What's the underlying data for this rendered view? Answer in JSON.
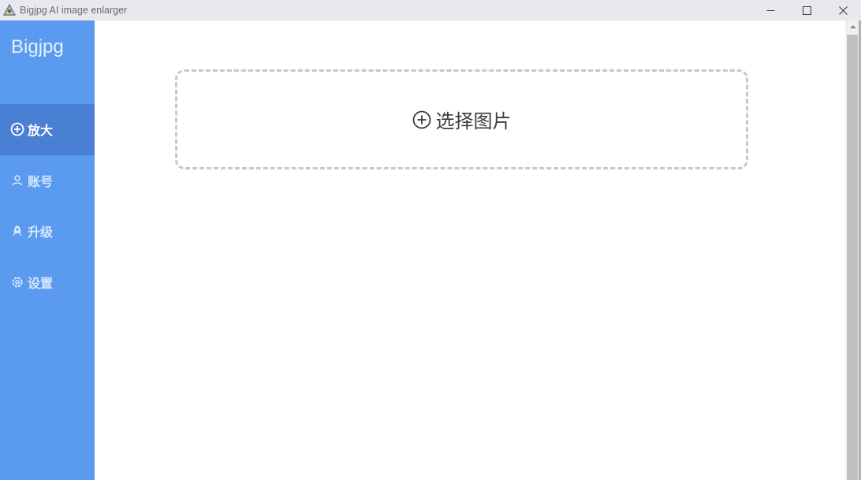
{
  "window": {
    "title": "Bigjpg AI image enlarger",
    "icon": "bigjpg-app-icon",
    "controls": [
      "minimize-icon",
      "maximize-icon",
      "close-icon"
    ]
  },
  "sidebar": {
    "brand": "Bigjpg",
    "background": "#5b9bef",
    "active_background": "#4a80d4",
    "items": [
      {
        "label": "放大",
        "icon": "plus-circle-icon",
        "active": true
      },
      {
        "label": "账号",
        "icon": "user-icon",
        "active": false
      },
      {
        "label": "升级",
        "icon": "rocket-icon",
        "active": false
      },
      {
        "label": "设置",
        "icon": "gear-icon",
        "active": false
      }
    ]
  },
  "main": {
    "dropzone": {
      "label": "选择图片",
      "icon": "plus-circle-icon"
    }
  }
}
